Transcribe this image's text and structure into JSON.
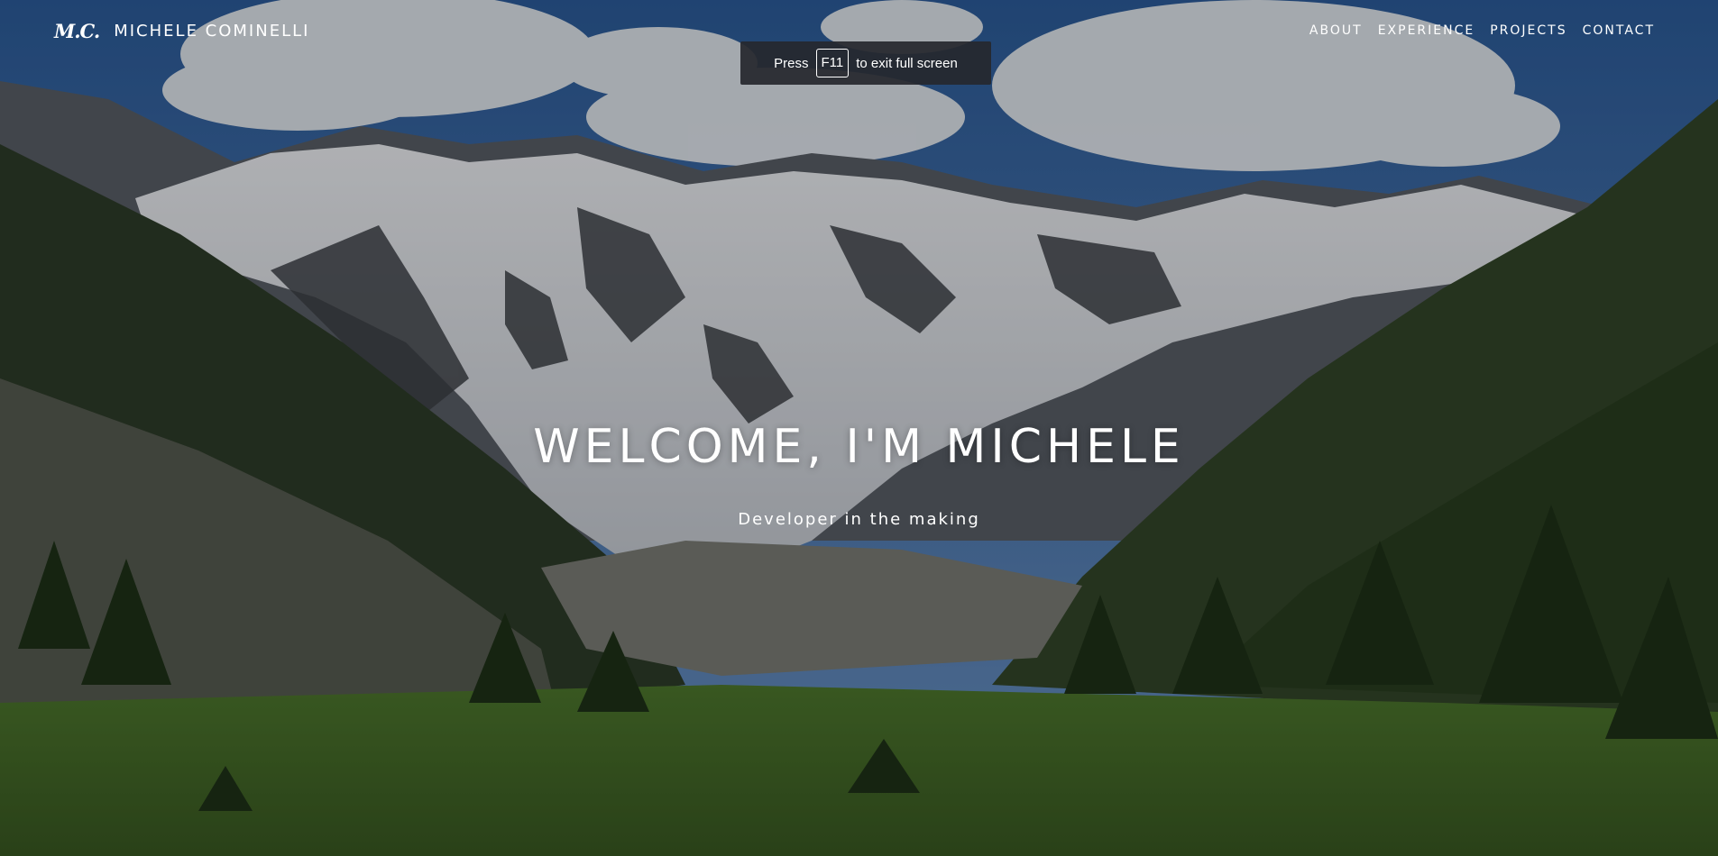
{
  "navbar": {
    "brand_mark": "M.C.",
    "brand_name": "MICHELE COMINELLI",
    "links": [
      {
        "label": "ABOUT"
      },
      {
        "label": "EXPERIENCE"
      },
      {
        "label": "PROJECTS"
      },
      {
        "label": "CONTACT"
      }
    ]
  },
  "fullscreen_notice": {
    "prefix": "Press",
    "key": "F11",
    "suffix": "to exit full screen"
  },
  "hero": {
    "title": "WELCOME, I'M MICHELE",
    "subtitle": "Developer in the making",
    "background": "mountain-valley-photo"
  },
  "colors": {
    "text": "#ffffff",
    "toast_bg": "#26282e",
    "sky": "#3b6aa8",
    "forest": "#2d4a22"
  }
}
